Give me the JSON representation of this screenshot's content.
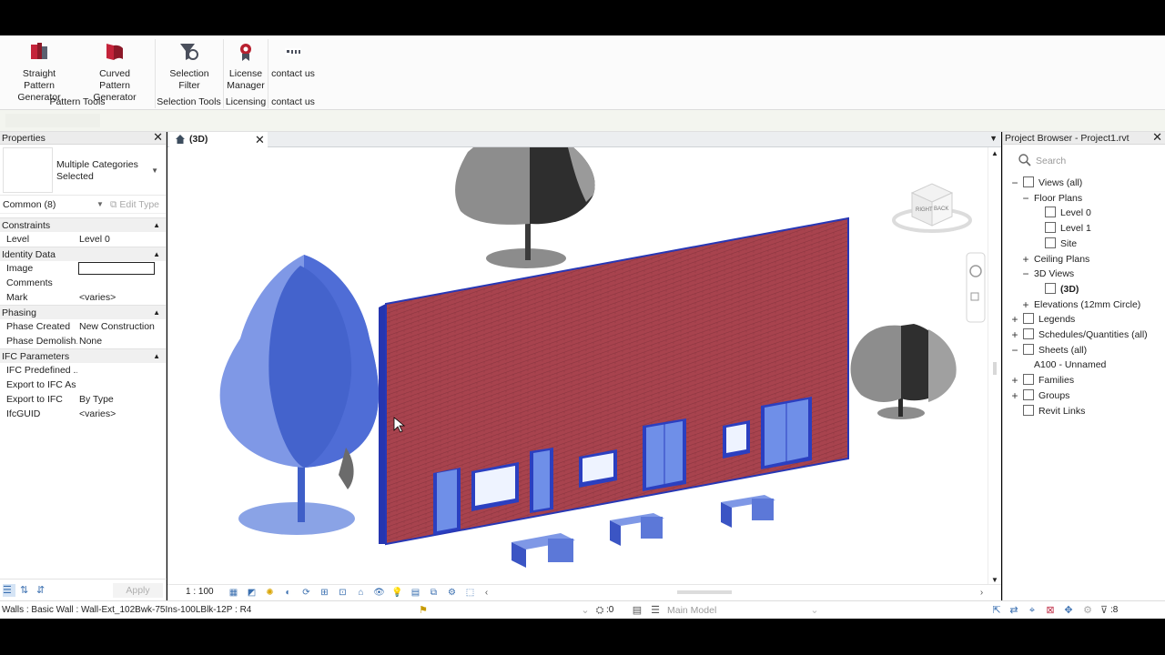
{
  "ribbon": {
    "buttons": [
      {
        "line1": "Straight",
        "line2": "Pattern Generator",
        "icon": "straight-pattern-icon"
      },
      {
        "line1": "Curved",
        "line2": "Pattern Generator",
        "icon": "curved-pattern-icon"
      },
      {
        "line1": "Selection",
        "line2": "Filter",
        "icon": "funnel-filter-icon"
      },
      {
        "line1": "License",
        "line2": "Manager",
        "icon": "license-icon"
      },
      {
        "line1": "contact us",
        "line2": "",
        "icon": "pixy-logo-icon"
      }
    ],
    "panels": [
      "Pattern Tools",
      "Selection Tools",
      "Licensing",
      "contact us"
    ],
    "accent": "#d7263d"
  },
  "properties": {
    "title": "Properties",
    "type_name": "Multiple Categories Selected",
    "filter": "Common (8)",
    "edit_type": "Edit Type",
    "sections": [
      {
        "name": "Constraints",
        "rows": [
          {
            "key": "Level",
            "value": "Level 0"
          }
        ]
      },
      {
        "name": "Identity Data",
        "rows": [
          {
            "key": "Image",
            "value": ""
          },
          {
            "key": "Comments",
            "value": ""
          },
          {
            "key": "Mark",
            "value": "<varies>"
          }
        ]
      },
      {
        "name": "Phasing",
        "rows": [
          {
            "key": "Phase Created",
            "value": "New Construction"
          },
          {
            "key": "Phase Demolish...",
            "value": "None"
          }
        ]
      },
      {
        "name": "IFC Parameters",
        "rows": [
          {
            "key": "IFC Predefined ...",
            "value": ""
          },
          {
            "key": "Export to IFC As",
            "value": ""
          },
          {
            "key": "Export to IFC",
            "value": "By Type"
          },
          {
            "key": "IfcGUID",
            "value": "<varies>"
          }
        ]
      }
    ],
    "apply": "Apply"
  },
  "view": {
    "tab": "(3D)",
    "scale": "1 : 100",
    "viewcube_labels": [
      "RIGHT",
      "BACK"
    ]
  },
  "browser": {
    "title": "Project Browser - Project1.rvt",
    "search_placeholder": "Search",
    "nodes": [
      {
        "label": "Views (all)",
        "level": 0,
        "exp": "−",
        "icon": true
      },
      {
        "label": "Floor Plans",
        "level": 1,
        "exp": "−",
        "icon": false
      },
      {
        "label": "Level 0",
        "level": 2,
        "exp": "",
        "icon": true
      },
      {
        "label": "Level 1",
        "level": 2,
        "exp": "",
        "icon": true
      },
      {
        "label": "Site",
        "level": 2,
        "exp": "",
        "icon": true
      },
      {
        "label": "Ceiling Plans",
        "level": 1,
        "exp": "+",
        "icon": false
      },
      {
        "label": "3D Views",
        "level": 1,
        "exp": "−",
        "icon": false
      },
      {
        "label": "(3D)",
        "level": 2,
        "exp": "",
        "icon": true,
        "bold": true
      },
      {
        "label": "Elevations (12mm Circle)",
        "level": 1,
        "exp": "+",
        "icon": false
      },
      {
        "label": "Legends",
        "level": 0,
        "exp": "+",
        "icon": true
      },
      {
        "label": "Schedules/Quantities (all)",
        "level": 0,
        "exp": "+",
        "icon": true
      },
      {
        "label": "Sheets (all)",
        "level": 0,
        "exp": "−",
        "icon": true
      },
      {
        "label": "A100 - Unnamed",
        "level": 1,
        "exp": "",
        "icon": false
      },
      {
        "label": "Families",
        "level": 0,
        "exp": "+",
        "icon": true
      },
      {
        "label": "Groups",
        "level": 0,
        "exp": "+",
        "icon": true
      },
      {
        "label": "Revit Links",
        "level": 0,
        "exp": "",
        "icon": true
      }
    ]
  },
  "status": {
    "text": "Walls : Basic Wall : Wall-Ext_102Bwk-75Ins-100LBlk-12P : R4",
    "worksets_count": ":0",
    "model": "Main Model",
    "filter_count": ":8"
  }
}
